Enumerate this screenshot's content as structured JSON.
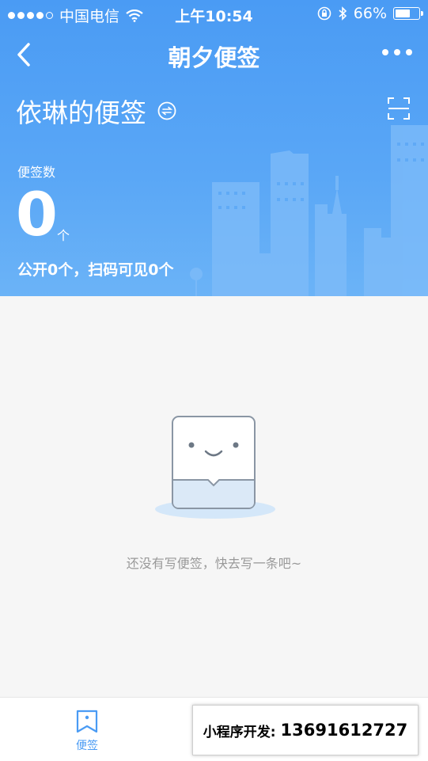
{
  "status_bar": {
    "carrier": "中国电信",
    "time": "上午10:54",
    "battery": "66%",
    "battery_level": 0.66
  },
  "navbar": {
    "title": "朝夕便签",
    "back_icon": "chevron-left-icon",
    "more_icon": "more-dots-icon"
  },
  "header": {
    "owner_title": "依琳的便签",
    "switch_icon": "switch-icon",
    "scan_icon": "scan-icon",
    "count_label": "便签数",
    "count_value": "0",
    "count_unit": "个",
    "count_sub": "公开0个，扫码可见0个"
  },
  "empty_state": {
    "message": "还没有写便签，快去写一条吧~",
    "illustration": "smiling-note-icon"
  },
  "tabbar": {
    "items": [
      {
        "label": "便签",
        "icon": "bookmark-icon",
        "active": true
      }
    ]
  },
  "promo": {
    "prefix": "小程序开发:",
    "phone": "13691612727"
  },
  "colors": {
    "primary": "#4a9bf4",
    "background": "#f6f6f6",
    "muted_text": "#999999"
  }
}
